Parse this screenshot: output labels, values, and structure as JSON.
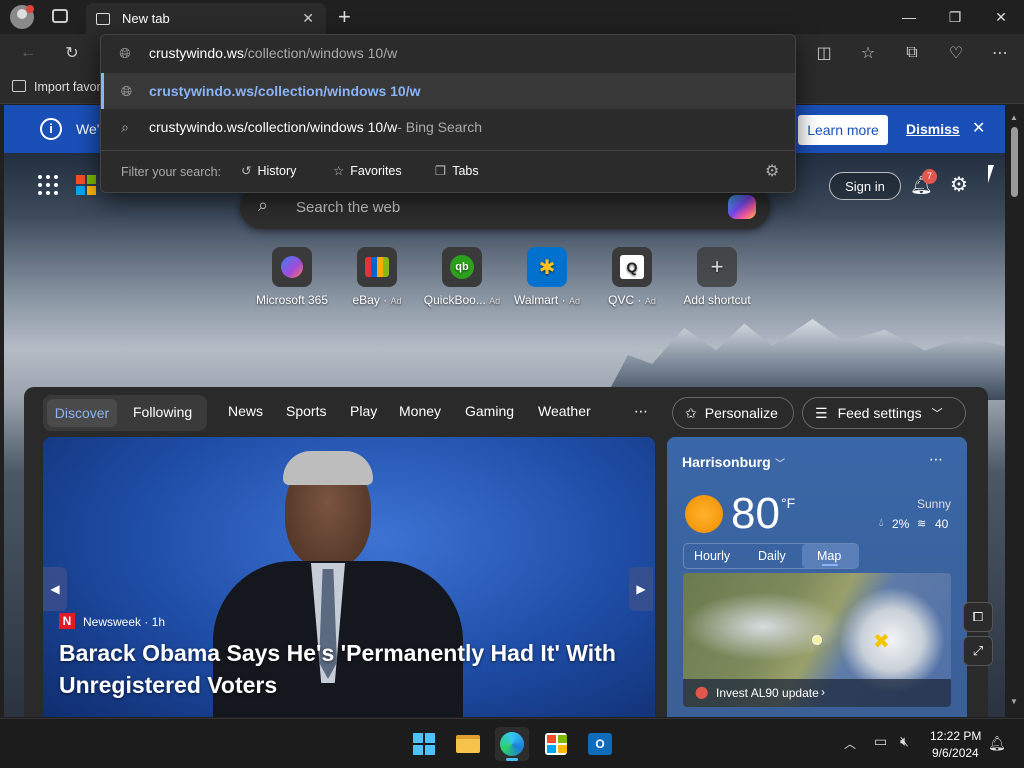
{
  "tab": {
    "title": "New tab"
  },
  "favbar": {
    "import_label": "Import favor"
  },
  "omnibox": {
    "input_host": "crustywindo.ws",
    "input_path": "/collection/windows 10/w",
    "suggestions": [
      {
        "text": "crustywindo.ws/collection/windows 10/w",
        "suffix": ""
      },
      {
        "text": "crustywindo.ws/collection/windows 10/w",
        "suffix": " - Bing Search"
      }
    ],
    "filter_label": "Filter your search:",
    "filters": [
      "History",
      "Favorites",
      "Tabs"
    ]
  },
  "banner": {
    "text": "We'",
    "learn_more": "Learn more",
    "dismiss": "Dismiss"
  },
  "header": {
    "sign_in": "Sign in",
    "notif_count": "7"
  },
  "search": {
    "placeholder": "Search the web"
  },
  "shortcuts": [
    {
      "label": "Microsoft 365",
      "ad": ""
    },
    {
      "label": "eBay",
      "ad": "Ad"
    },
    {
      "label": "QuickBoo...",
      "ad": "Ad"
    },
    {
      "label": "Walmart",
      "ad": "Ad"
    },
    {
      "label": "QVC",
      "ad": "Ad"
    },
    {
      "label": "Add shortcut",
      "ad": ""
    }
  ],
  "feed": {
    "tabs": [
      "Discover",
      "Following"
    ],
    "nav": [
      "News",
      "Sports",
      "Play",
      "Money",
      "Gaming",
      "Weather"
    ],
    "personalize": "Personalize",
    "feed_settings": "Feed settings"
  },
  "hero": {
    "source": "Newsweek · 1h",
    "headline": "Barack Obama Says He's 'Permanently Had It' With Unregistered Voters"
  },
  "weather": {
    "location": "Harrisonburg",
    "temp": "80",
    "unit": "°F",
    "condition": "Sunny",
    "precip": "2%",
    "wind": "40",
    "tabs": [
      "Hourly",
      "Daily",
      "Map"
    ],
    "map_caption": "Invest AL90 update"
  },
  "taskbar": {
    "time": "12:22 PM",
    "date": "9/6/2024"
  },
  "colors": {
    "accent": "#1a4fb8",
    "link": "#8ab4f8"
  }
}
